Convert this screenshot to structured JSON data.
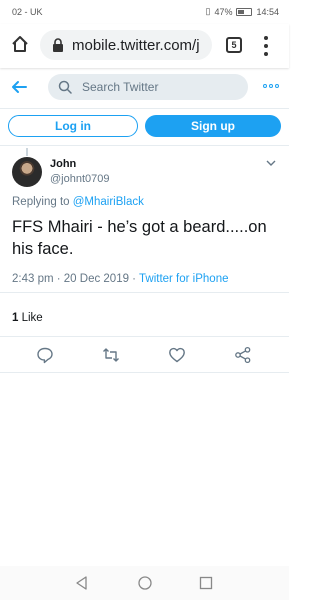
{
  "status_bar": {
    "carrier": "02 - UK",
    "battery": "47%",
    "time": "14:54"
  },
  "browser": {
    "url": "mobile.twitter.com/j",
    "tab_count": "5"
  },
  "twitter_header": {
    "search_placeholder": "Search Twitter"
  },
  "auth": {
    "login_label": "Log in",
    "signup_label": "Sign up"
  },
  "tweet": {
    "author_name": "John",
    "author_handle": "@johnt0709",
    "replying_prefix": "Replying to ",
    "replying_to": "@MhairiBlack",
    "text": "FFS Mhairi - he’s got a beard.....on his face.",
    "time_date": "2:43 pm · 20 Dec 2019 · ",
    "source": "Twitter for iPhone",
    "like_count": "1",
    "like_label": " Like"
  },
  "colors": {
    "accent": "#1da1f2",
    "secondary_text": "#657786",
    "divider": "#e6ecf0"
  }
}
